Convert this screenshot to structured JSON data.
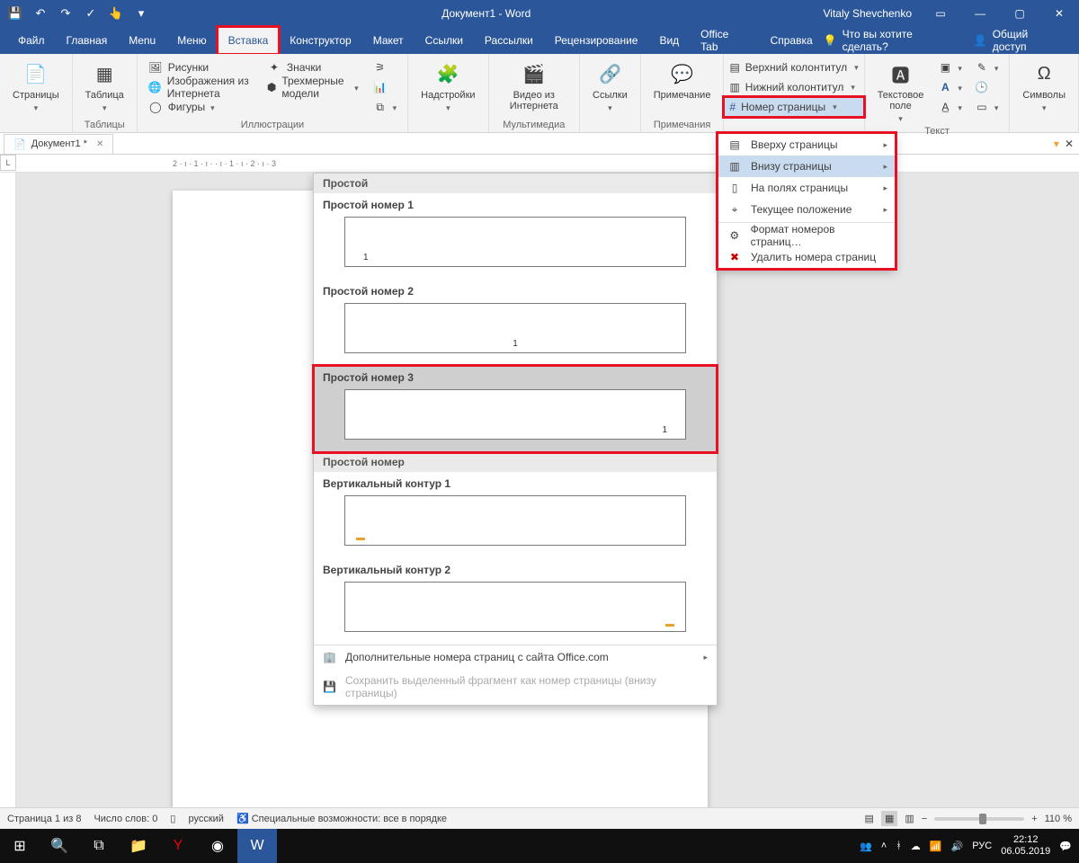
{
  "titlebar": {
    "doc_title": "Документ1 - Word",
    "user": "Vitaly Shevchenko"
  },
  "tabs": {
    "file": "Файл",
    "home": "Главная",
    "menu_en": "Menu",
    "menu_ru": "Меню",
    "insert": "Вставка",
    "design": "Конструктор",
    "layout": "Макет",
    "references": "Ссылки",
    "mailings": "Рассылки",
    "review": "Рецензирование",
    "view": "Вид",
    "officetab": "Office Tab",
    "help": "Справка",
    "tellme": "Что вы хотите сделать?",
    "share": "Общий доступ"
  },
  "ribbon": {
    "pages": "Страницы",
    "table": "Таблица",
    "tables": "Таблицы",
    "pictures": "Рисунки",
    "online_pics": "Изображения из Интернета",
    "shapes": "Фигуры",
    "icons_btn": "Значки",
    "models3d": "Трехмерные модели",
    "illustrations": "Иллюстрации",
    "addins": "Надстройки",
    "video": "Видео из Интернета",
    "media": "Мультимедиа",
    "links": "Ссылки",
    "comment": "Примечание",
    "comments": "Примечания",
    "header": "Верхний колонтитул",
    "footer": "Нижний колонтитул",
    "pagenum": "Номер страницы",
    "textbox": "Текстовое поле",
    "text": "Текст",
    "symbols": "Символы"
  },
  "pagenum_menu": {
    "top": "Вверху страницы",
    "bottom": "Внизу страницы",
    "margins": "На полях страницы",
    "current": "Текущее положение",
    "format": "Формат номеров страниц…",
    "remove": "Удалить номера страниц"
  },
  "gallery": {
    "hdr1": "Простой",
    "item1": "Простой номер 1",
    "item2": "Простой номер 2",
    "item3": "Простой номер 3",
    "hdr2": "Простой номер",
    "item4": "Вертикальный контур 1",
    "item5": "Вертикальный контур 2",
    "more": "Дополнительные номера страниц с сайта Office.com",
    "save": "Сохранить выделенный фрагмент как номер страницы (внизу страницы)",
    "num": "1"
  },
  "doctab": {
    "name": "Документ1 *"
  },
  "status": {
    "page": "Страница 1 из 8",
    "words": "Число слов: 0",
    "lang": "русский",
    "a11y": "Специальные возможности: все в порядке",
    "zoom": "110 %"
  },
  "ruler": {
    "marks": "2 · ı · 1 · ı ·     · ı · 1 · ı · 2 · ı · 3"
  },
  "taskbar": {
    "lang": "РУС",
    "time": "22:12",
    "date": "06.05.2019"
  }
}
